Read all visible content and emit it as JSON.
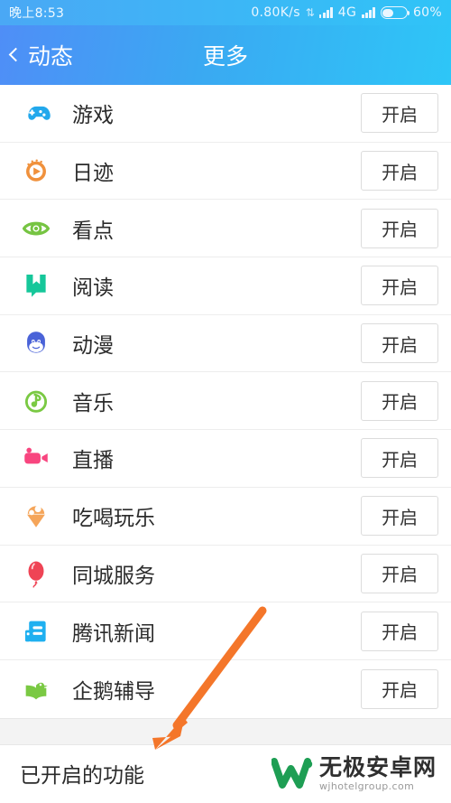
{
  "status_bar": {
    "time": "晚上8:53",
    "network_speed": "0.80K/s",
    "data_arrows_icon": "data-transfer-icon",
    "signal1_icon": "signal-bars-icon",
    "network_type": "4G",
    "signal2_icon": "signal-bars-icon",
    "battery_icon": "battery-icon",
    "battery_percent": "60%"
  },
  "header": {
    "back_icon": "chevron-left-icon",
    "back_label": "动态",
    "title": "更多",
    "gradient_from": "#4f8ef7",
    "gradient_to": "#2ec6f7"
  },
  "list": {
    "action_label": "开启",
    "items": [
      {
        "label": "游戏",
        "icon": "gamepad-icon",
        "color": "#22a8ec",
        "action": "开启"
      },
      {
        "label": "日迹",
        "icon": "play-circle-icon",
        "color": "#f0913c",
        "action": "开启"
      },
      {
        "label": "看点",
        "icon": "eye-icon",
        "color": "#76c442",
        "action": "开启"
      },
      {
        "label": "阅读",
        "icon": "bookmark-icon",
        "color": "#16c79a",
        "action": "开启"
      },
      {
        "label": "动漫",
        "icon": "cartoon-face-icon",
        "color": "#4a63d8",
        "action": "开启"
      },
      {
        "label": "音乐",
        "icon": "music-note-icon",
        "color": "#7ac943",
        "action": "开启"
      },
      {
        "label": "直播",
        "icon": "video-camera-icon",
        "color": "#f8457f",
        "action": "开启"
      },
      {
        "label": "吃喝玩乐",
        "icon": "ice-cream-icon",
        "color": "#f5a55a",
        "action": "开启"
      },
      {
        "label": "同城服务",
        "icon": "balloon-icon",
        "color": "#ef4455",
        "action": "开启"
      },
      {
        "label": "腾讯新闻",
        "icon": "newspaper-icon",
        "color": "#1fb0f0",
        "action": "开启"
      },
      {
        "label": "企鹅辅导",
        "icon": "penguin-book-icon",
        "color": "#7ac943",
        "action": "开启"
      }
    ]
  },
  "footer": {
    "label": "已开启的功能",
    "watermark_logo_icon": "w-logo-icon",
    "watermark_name": "无极安卓网",
    "watermark_url": "wjhotelgroup.com",
    "watermark_color": "#1e9e54"
  },
  "annotation": {
    "arrow_icon": "orange-arrow-icon",
    "color": "#f4762a"
  }
}
